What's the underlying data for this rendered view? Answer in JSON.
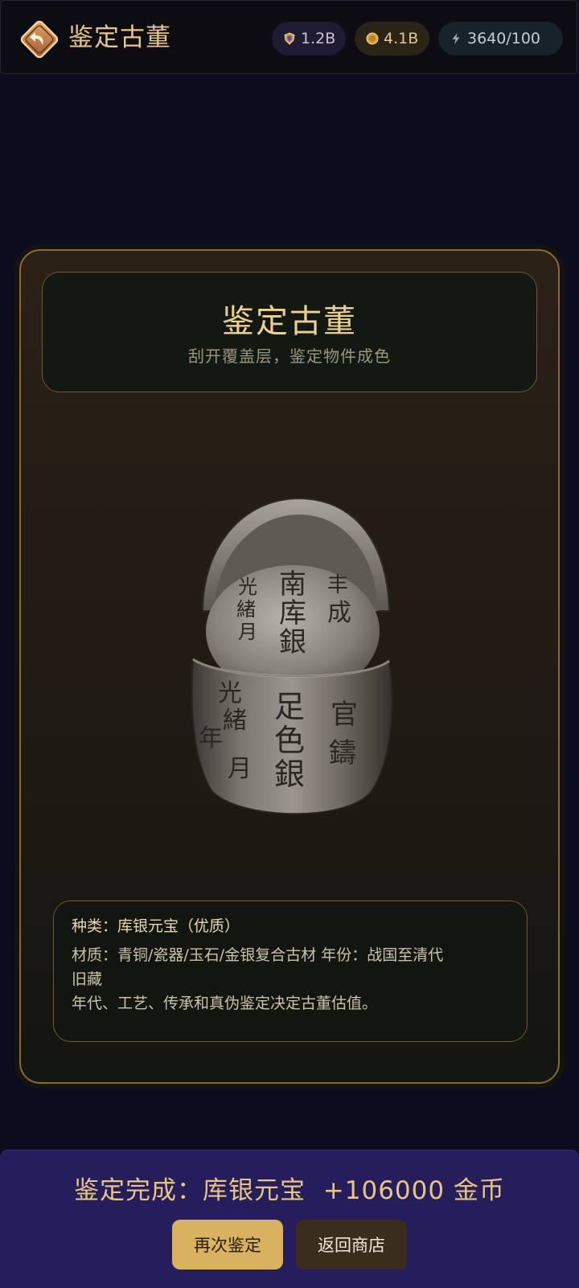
{
  "header": {
    "back_icon": "back-arrow-icon",
    "title": "鉴定古董"
  },
  "resources": {
    "gems": {
      "icon": "shield-gem-icon",
      "value": "1.2B"
    },
    "coins": {
      "icon": "gold-coin-icon",
      "value": "4.1B"
    },
    "energy": {
      "icon": "lightning-icon",
      "value": "3640/100"
    }
  },
  "card": {
    "title": "鉴定古董",
    "subtitle": "刮开覆盖层，鉴定物件成色",
    "artifact_icon": "silver-ingot-image",
    "artifact_inscriptions": {
      "top_left": [
        "光",
        "緒",
        "月"
      ],
      "top_mid": [
        "南",
        "库",
        "銀"
      ],
      "top_right": [
        "丰",
        "成"
      ],
      "front_left": [
        "光",
        "緒",
        "年",
        "月"
      ],
      "front_mid": [
        "足",
        "色",
        "銀"
      ],
      "front_right": [
        "官",
        "鑄"
      ]
    },
    "info": {
      "category": "种类：库银元宝（优质）",
      "material_line_1": "材质：青铜/瓷器/玉石/金银复合古材  年份：战国至清代",
      "material_line_2": "旧藏",
      "note": "年代、工艺、传承和真伪鉴定决定古董估值。"
    }
  },
  "footer": {
    "result": "鉴定完成：库银元宝  +106000 金币",
    "again_button": "再次鉴定",
    "shop_button": "返回商店"
  },
  "colors": {
    "background": "#0d0c1e",
    "gold_text": "#e6c688",
    "card_border": "#8a6a32",
    "bottom_bar": "#261e5c",
    "primary_button": "#d8b25f",
    "secondary_button": "#3a2d1d"
  }
}
